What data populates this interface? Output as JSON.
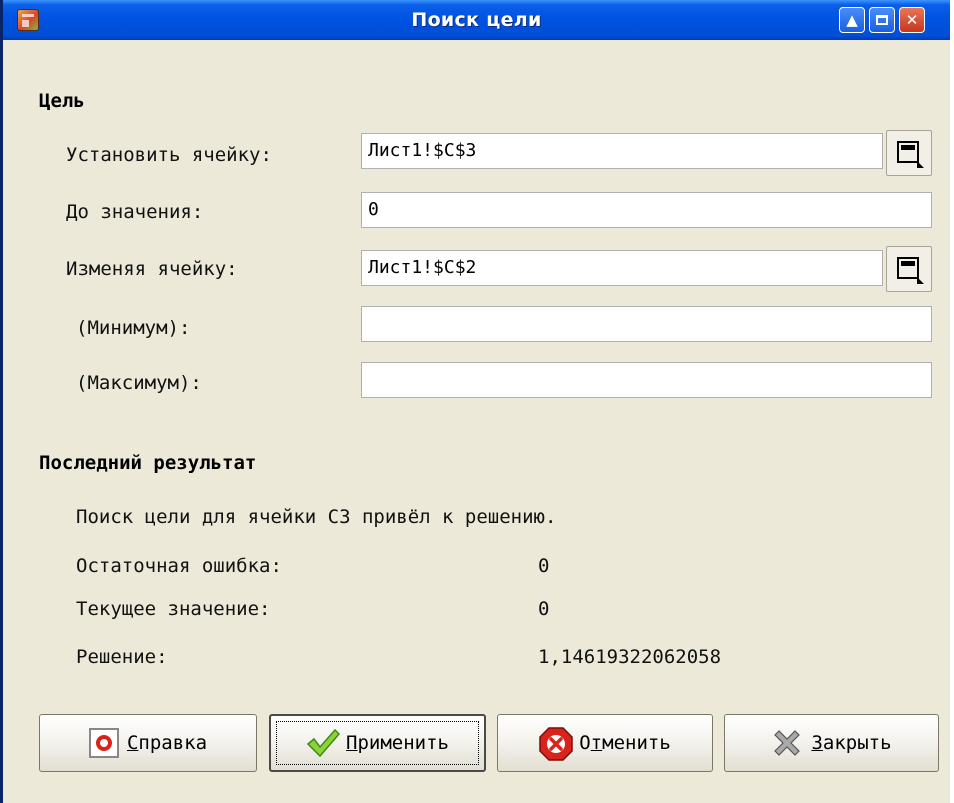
{
  "window": {
    "title": "Поиск цели"
  },
  "section_goal": {
    "heading": "Цель",
    "set_cell_label": "Установить ячейку:",
    "set_cell_value": "Лист1!$C$3",
    "target_value_label": "До значения:",
    "target_value": "0",
    "changing_cell_label": "Изменяя ячейку:",
    "changing_cell_value": "Лист1!$C$2",
    "minimum_label": "(Минимум):",
    "minimum_value": "",
    "maximum_label": "(Максимум):",
    "maximum_value": ""
  },
  "section_result": {
    "heading": "Последний результат",
    "message": "Поиск цели для ячейки С3 привёл к решению.",
    "residual_label": "Остаточная ошибка:",
    "residual_value": "0",
    "current_label": "Текущее значение:",
    "current_value": "0",
    "solution_label": "Решение:",
    "solution_value": "1,14619322062058"
  },
  "buttons": {
    "help_first": "С",
    "help_rest": "правка",
    "apply_first": "П",
    "apply_rest": "рименить",
    "cancel_first": "О",
    "cancel_mid": "т",
    "cancel_rest": "менить",
    "close_first": "З",
    "close_rest": "акрыть"
  },
  "colors": {
    "titlebar": "#0052E0",
    "dialog_bg": "#ECE9D8",
    "close_button": "#C5361D"
  }
}
